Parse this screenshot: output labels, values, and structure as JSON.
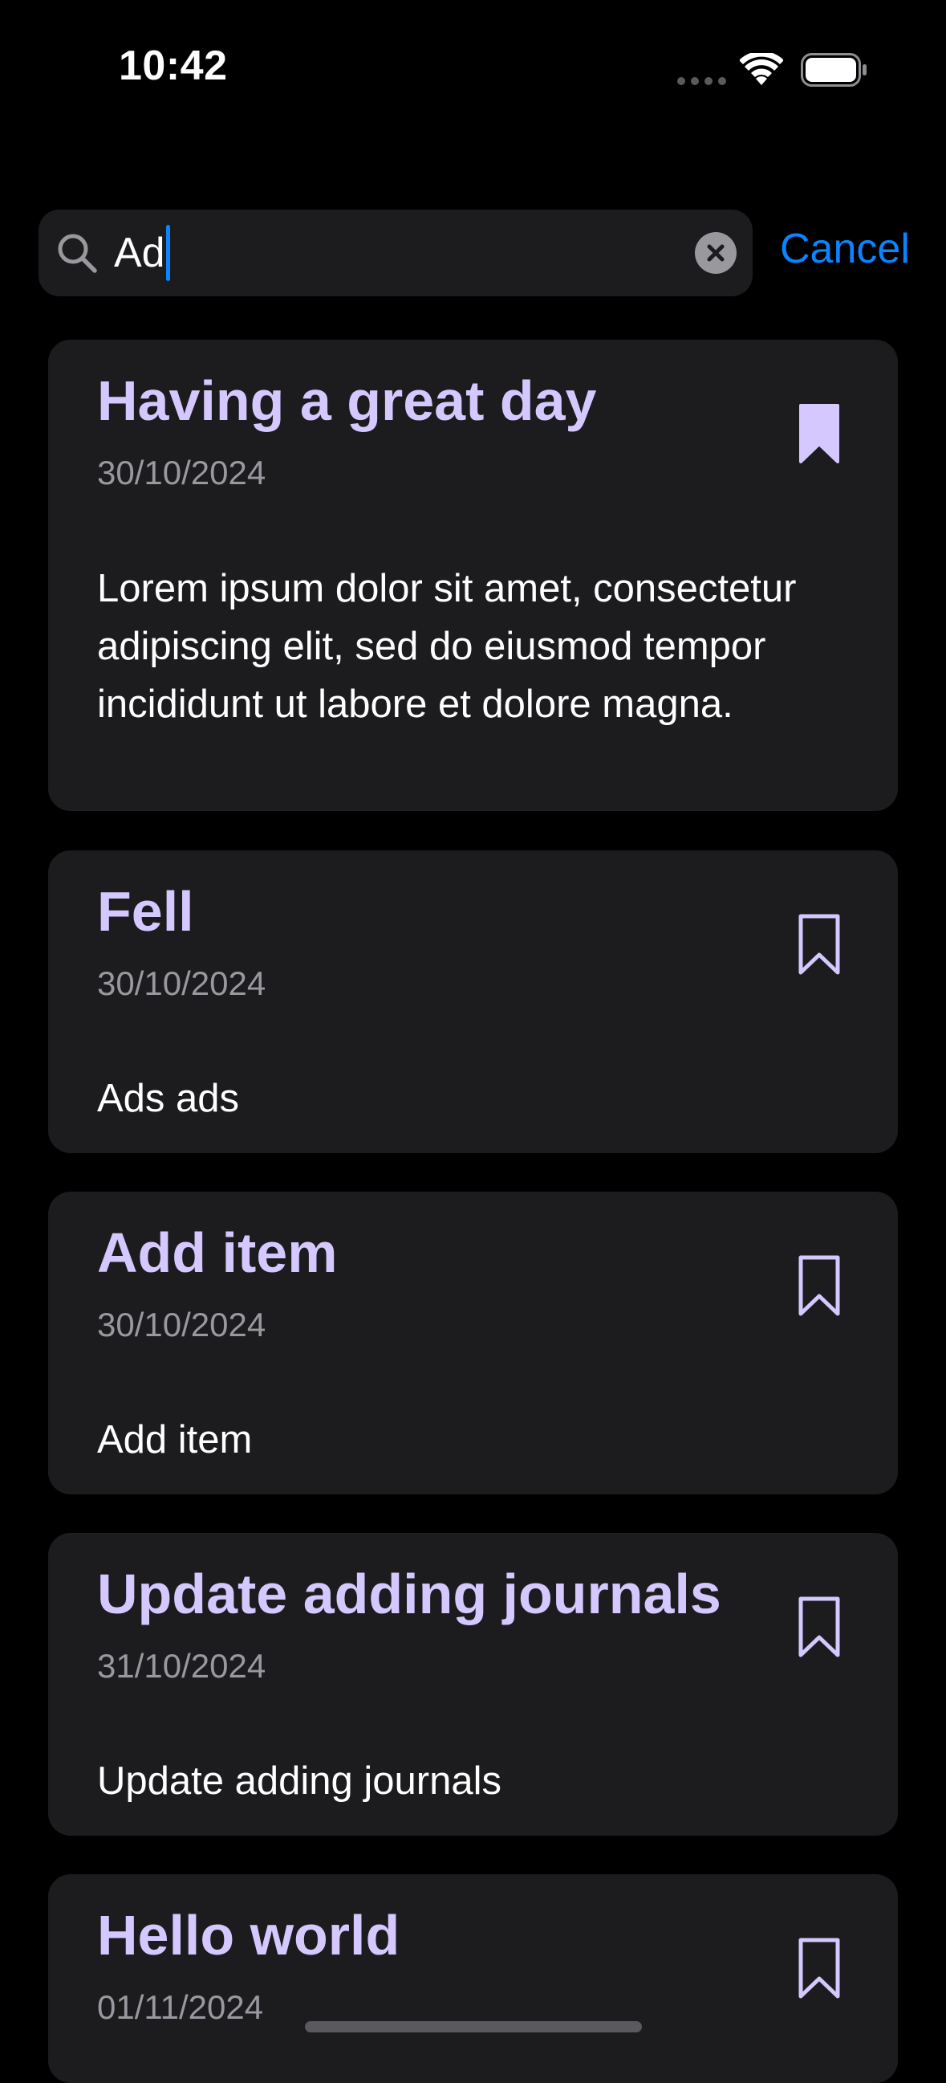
{
  "status": {
    "time": "10:42"
  },
  "search": {
    "query": "Ad",
    "cancel_label": "Cancel"
  },
  "colors": {
    "accent": "#0a84ff",
    "title": "#d4c8ff",
    "card_background": "#1c1c1e",
    "date": "#98989f"
  },
  "entries": [
    {
      "title": "Having a great day",
      "date": "30/10/2024",
      "body": "Lorem ipsum dolor sit amet, consectetur adipiscing elit, sed do eiusmod tempor incididunt ut labore et dolore magna.",
      "bookmarked": true
    },
    {
      "title": "Fell",
      "date": "30/10/2024",
      "body": "Ads ads",
      "bookmarked": false
    },
    {
      "title": "Add item",
      "date": "30/10/2024",
      "body": "Add item",
      "bookmarked": false
    },
    {
      "title": "Update adding journals",
      "date": "31/10/2024",
      "body": "Update adding journals",
      "bookmarked": false
    },
    {
      "title": "Hello world",
      "date": "01/11/2024",
      "body": "",
      "bookmarked": false
    }
  ]
}
